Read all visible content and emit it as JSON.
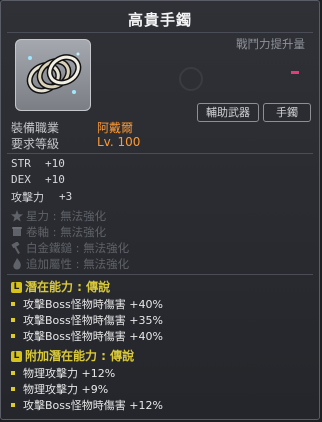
{
  "title": "高貴手鐲",
  "combat_power_label": "戰鬥力提升量",
  "item_icon": "silver-rings-bracelet",
  "tags": [
    "輔助武器",
    "手鐲"
  ],
  "requirements": {
    "job_label": "裝備職業",
    "job_value": "阿戴爾",
    "level_label": "要求等級",
    "level_value": "Lv. 100"
  },
  "stats": [
    {
      "key": "STR",
      "value": "+10"
    },
    {
      "key": "DEX",
      "value": "+10"
    },
    {
      "key": "攻擊力",
      "value": "+3"
    }
  ],
  "enhancements": [
    {
      "icon": "star-icon",
      "label": "星力",
      "value": "無法強化"
    },
    {
      "icon": "scroll-icon",
      "label": "卷軸",
      "value": "無法強化"
    },
    {
      "icon": "hammer-icon",
      "label": "白金鐵鎚",
      "value": "無法強化"
    },
    {
      "icon": "flame-icon",
      "label": "追加屬性",
      "value": "無法強化"
    }
  ],
  "potential": {
    "badge": "L",
    "title": "潛在能力 : 傳說",
    "lines": [
      "攻擊Boss怪物時傷害 +40%",
      "攻擊Boss怪物時傷害 +35%",
      "攻擊Boss怪物時傷害 +40%"
    ]
  },
  "bonus_potential": {
    "badge": "L",
    "title": "附加潛在能力 : 傳說",
    "lines": [
      "物理攻擊力 +12%",
      "物理攻擊力 +9%",
      "攻擊Boss怪物時傷害 +12%"
    ]
  },
  "colors": {
    "legendary": "#d6c21d",
    "job": "#ff9933",
    "combat_power": "#e8397a"
  }
}
